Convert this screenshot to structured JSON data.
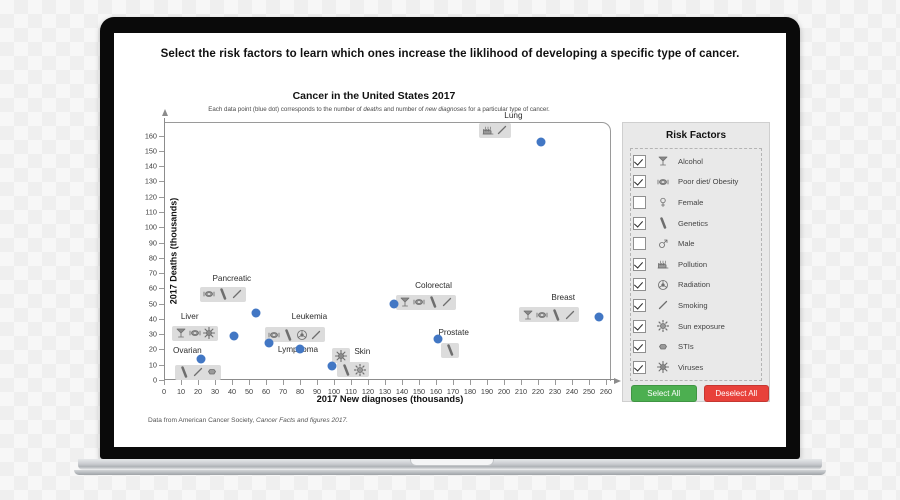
{
  "headline": "Select the risk factors to learn which ones increase the liklihood of developing a specific type of cancer.",
  "chart": {
    "title": "Cancer in the United States 2017",
    "subtitle_a": "Each data point (blue dot) corresponds to the number of ",
    "subtitle_deaths": "deaths",
    "subtitle_b": " and number of ",
    "subtitle_new": "new diagnoses",
    "subtitle_c": " for a particular type of cancer.",
    "source_a": "Data from American Cancer Society, ",
    "source_b": "Cancer Facts and figures 2017."
  },
  "chart_data": {
    "type": "scatter",
    "title": "Cancer in the United States 2017",
    "xlabel": "2017 New diagnoses (thousands)",
    "ylabel": "2017 Deaths (thousands)",
    "xlim": [
      0,
      260
    ],
    "ylim": [
      0,
      165
    ],
    "xticks": [
      0,
      10,
      20,
      30,
      40,
      50,
      60,
      70,
      80,
      90,
      100,
      110,
      120,
      130,
      140,
      150,
      160,
      170,
      180,
      190,
      200,
      210,
      220,
      230,
      240,
      250,
      260
    ],
    "yticks": [
      0,
      10,
      20,
      30,
      40,
      50,
      60,
      70,
      80,
      90,
      100,
      110,
      120,
      130,
      140,
      150,
      160
    ],
    "grid": false,
    "legend": "none",
    "dot_color": "#4277c4",
    "points": [
      {
        "name": "Lung",
        "x": 222,
        "y": 156,
        "factors": [
          "pollution",
          "smoking"
        ]
      },
      {
        "name": "Pancreatic",
        "x": 54,
        "y": 44,
        "factors": [
          "diet",
          "genetics",
          "smoking"
        ]
      },
      {
        "name": "Colorectal",
        "x": 135,
        "y": 50,
        "factors": [
          "alcohol",
          "diet",
          "genetics",
          "smoking"
        ]
      },
      {
        "name": "Breast",
        "x": 256,
        "y": 41,
        "factors": [
          "alcohol",
          "diet",
          "genetics",
          "smoking"
        ]
      },
      {
        "name": "Liver",
        "x": 41,
        "y": 29,
        "factors": [
          "alcohol",
          "diet",
          "viruses"
        ]
      },
      {
        "name": "Leukemia",
        "x": 62,
        "y": 24,
        "factors": [
          "diet",
          "genetics",
          "radiation",
          "smoking"
        ]
      },
      {
        "name": "Prostate",
        "x": 161,
        "y": 27,
        "factors": [
          "genetics"
        ]
      },
      {
        "name": "Ovarian",
        "x": 22,
        "y": 14,
        "factors": [
          "genetics",
          "smoking",
          "stis"
        ]
      },
      {
        "name": "Lymphoma",
        "x": 80,
        "y": 20,
        "factors": [
          "viruses"
        ]
      },
      {
        "name": "Skin",
        "x": 99,
        "y": 9,
        "factors": [
          "genetics",
          "sun"
        ]
      }
    ]
  },
  "panel": {
    "title": "Risk Factors",
    "items": [
      {
        "label": "Alcohol",
        "icon": "alcohol-icon",
        "checked": true
      },
      {
        "label": "Poor diet/ Obesity",
        "icon": "diet-icon",
        "checked": true
      },
      {
        "label": "Female",
        "icon": "female-icon",
        "checked": false
      },
      {
        "label": "Genetics",
        "icon": "genetics-icon",
        "checked": true
      },
      {
        "label": "Male",
        "icon": "male-icon",
        "checked": false
      },
      {
        "label": "Pollution",
        "icon": "pollution-icon",
        "checked": true
      },
      {
        "label": "Radiation",
        "icon": "radiation-icon",
        "checked": true
      },
      {
        "label": "Smoking",
        "icon": "smoking-icon",
        "checked": true
      },
      {
        "label": "Sun exposure",
        "icon": "sun-icon",
        "checked": true
      },
      {
        "label": "STIs",
        "icon": "stis-icon",
        "checked": true
      },
      {
        "label": "Viruses",
        "icon": "viruses-icon",
        "checked": true
      }
    ],
    "select_all": "Select All",
    "deselect_all": "Deselect All",
    "select_all_color": "#4caf50",
    "deselect_all_color": "#e8413a"
  }
}
